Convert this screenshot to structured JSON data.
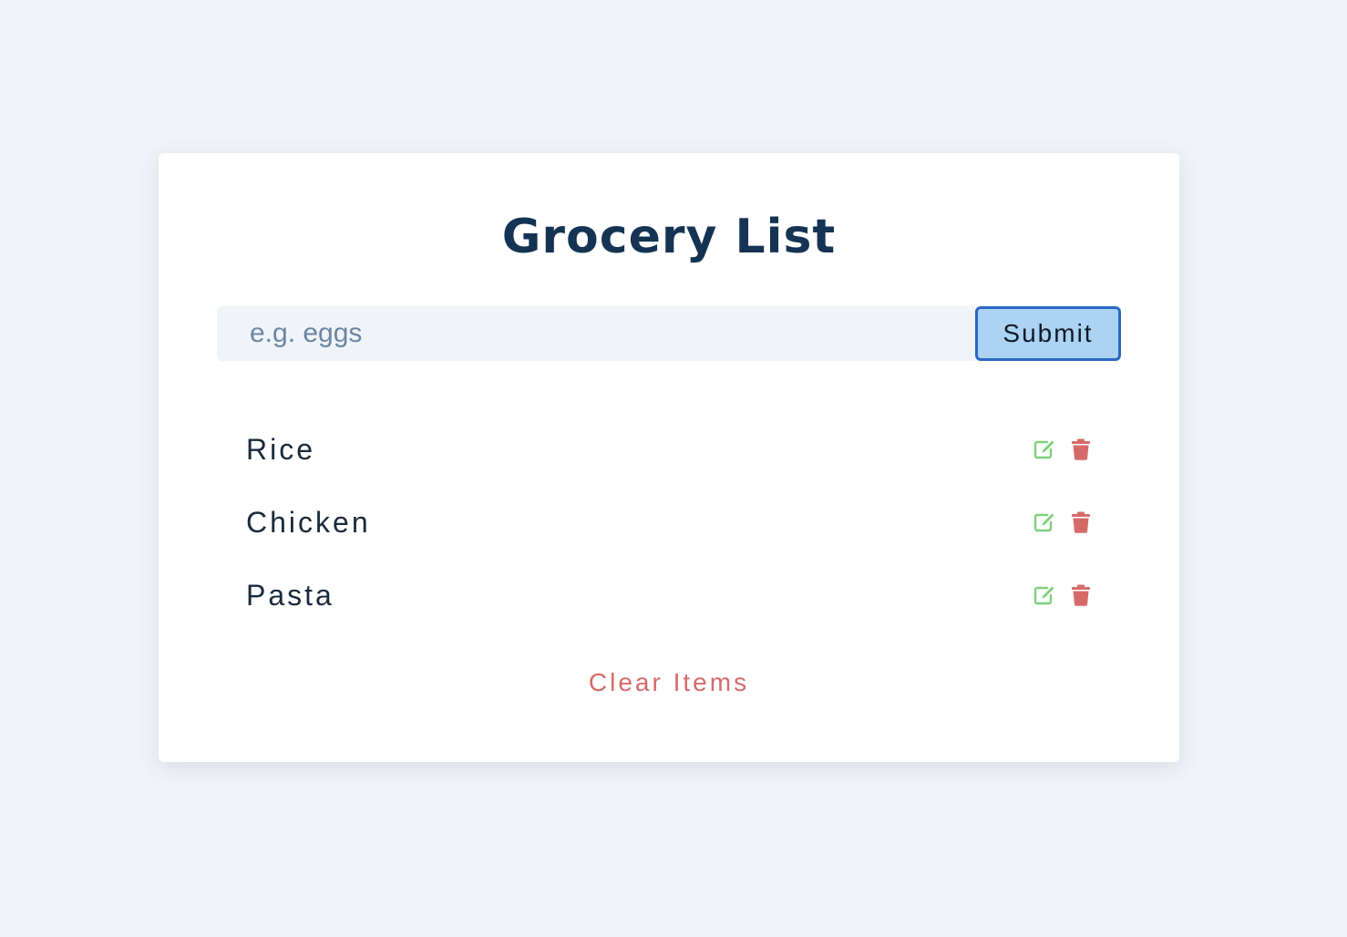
{
  "title": "Grocery List",
  "form": {
    "placeholder": "e.g. eggs",
    "value": "",
    "submit_label": "Submit"
  },
  "items": [
    {
      "name": "Rice"
    },
    {
      "name": "Chicken"
    },
    {
      "name": "Pasta"
    }
  ],
  "icons": {
    "edit": "edit-icon",
    "delete": "trash-icon"
  },
  "colors": {
    "edit": "#7ed07a",
    "delete": "#d66a6a",
    "title": "#153454",
    "submit_bg": "#acd3f3",
    "submit_border": "#2a68c5"
  },
  "clear_label": "Clear Items"
}
